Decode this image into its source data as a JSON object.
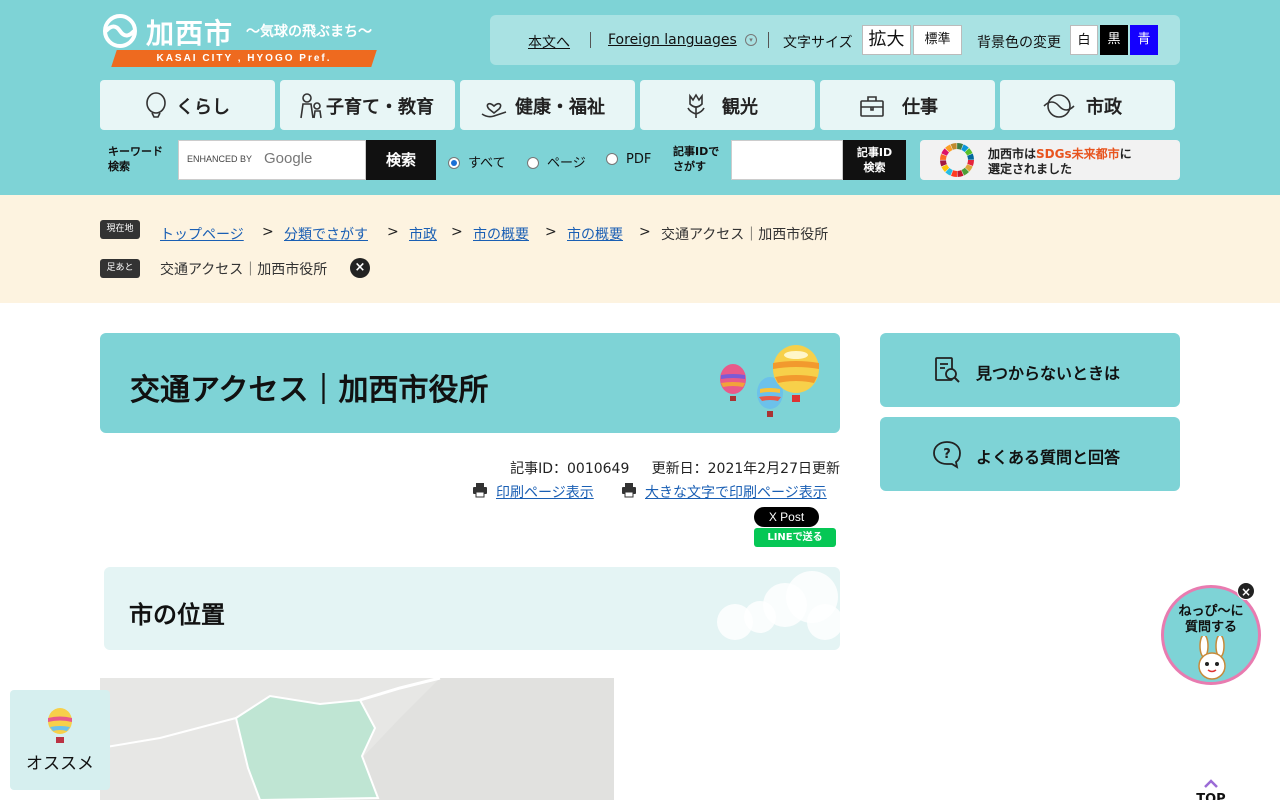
{
  "header": {
    "logo_name": "加西市",
    "logo_catch": "〜気球の飛ぶまち〜",
    "logo_band": "KASAI CITY , HYOGO Pref.",
    "util": {
      "honbun": "本文へ",
      "foreign": "Foreign languages",
      "font_size_label": "文字サイズ",
      "font_large": "拡大",
      "font_standard": "標準",
      "bg_label": "背景色の変更",
      "bg_white": "白",
      "bg_black": "黒",
      "bg_blue": "青"
    },
    "nav": [
      {
        "label": "くらし",
        "icon": "balloon-icon"
      },
      {
        "label": "子育て・教育",
        "icon": "parent-child-icon"
      },
      {
        "label": "健康・福祉",
        "icon": "hand-heart-icon"
      },
      {
        "label": "観光",
        "icon": "tulip-icon"
      },
      {
        "label": "仕事",
        "icon": "briefcase-icon"
      },
      {
        "label": "市政",
        "icon": "city-logo-icon"
      }
    ],
    "search": {
      "keyword_label_1": "キーワード",
      "keyword_label_2": "検索",
      "enhanced": "ENHANCED BY",
      "google": "Google",
      "button": "検索",
      "radios": [
        "すべて",
        "ページ",
        "PDF"
      ],
      "selected": "すべて",
      "id_label_1": "記事IDで",
      "id_label_2": "さがす",
      "id_button_1": "記事ID",
      "id_button_2": "検索"
    },
    "sdgs": {
      "line1_pre": "加西市は",
      "line1_hl": "SDGs未来都市",
      "line1_post": "に",
      "line2": "選定されました"
    }
  },
  "breadcrumb": {
    "current_tag": "現在地",
    "footprint_tag": "足あと",
    "items": [
      "トップページ",
      "分類でさがす",
      "市政",
      "市の概要",
      "市の概要"
    ],
    "separator": ">",
    "current": "交通アクセス｜加西市役所",
    "footprint": "交通アクセス｜加西市役所"
  },
  "main": {
    "title": "交通アクセス｜加西市役所",
    "article_id": "記事ID：0010649",
    "updated": "更新日：2021年2月27日更新",
    "print": "印刷ページ表示",
    "print_large": "大きな文字で印刷ページ表示",
    "x_post": "X Post",
    "line": "LINEで送る",
    "section_title": "市の位置"
  },
  "sidebar": {
    "not_found": "見つからないときは",
    "faq": "よくある質問と回答"
  },
  "floating": {
    "ask_line1": "ねっぴ〜に",
    "ask_line2": "質問する",
    "osusume": "オススメ",
    "top": "TOP"
  },
  "colors": {
    "header_bg": "#7ed3d6",
    "accent_orange": "#ee6a1f",
    "crumb_bg": "#fdf3e0",
    "link": "#1a5fb4"
  }
}
